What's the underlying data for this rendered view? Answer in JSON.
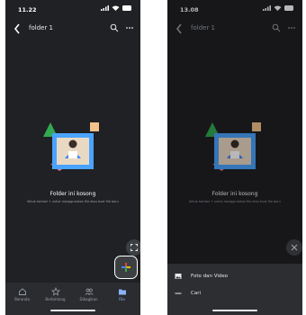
{
  "left": {
    "status": {
      "time": "11.22"
    },
    "appbar": {
      "title": "folder 1"
    },
    "empty_state": {
      "title": "Folder ini kosong",
      "subtitle": "Ketuk tombol + untuk menggunakan file atau buat file baru"
    },
    "nav": {
      "items": [
        {
          "label": "Beranda",
          "icon": "home-icon"
        },
        {
          "label": "Berbintang",
          "icon": "star-icon"
        },
        {
          "label": "Dibagikan",
          "icon": "people-icon"
        },
        {
          "label": "File",
          "icon": "folder-icon",
          "active": true
        }
      ]
    }
  },
  "right": {
    "status": {
      "time": "13.08"
    },
    "appbar": {
      "title": "folder 1"
    },
    "empty_state": {
      "title": "Folder ini kosong",
      "subtitle": "Ketuk tombol + untuk menggunakan file atau buat file baru"
    },
    "sheet": {
      "items": [
        {
          "label": "Foto dan Video",
          "icon": "photo-icon"
        },
        {
          "label": "Cari",
          "icon": "search-icon"
        }
      ]
    }
  },
  "colors": {
    "background": "#202124",
    "accent": "#8ab4f8",
    "fab_plus": [
      "#4285f4",
      "#ea4335",
      "#fbbc04",
      "#34a853"
    ]
  }
}
